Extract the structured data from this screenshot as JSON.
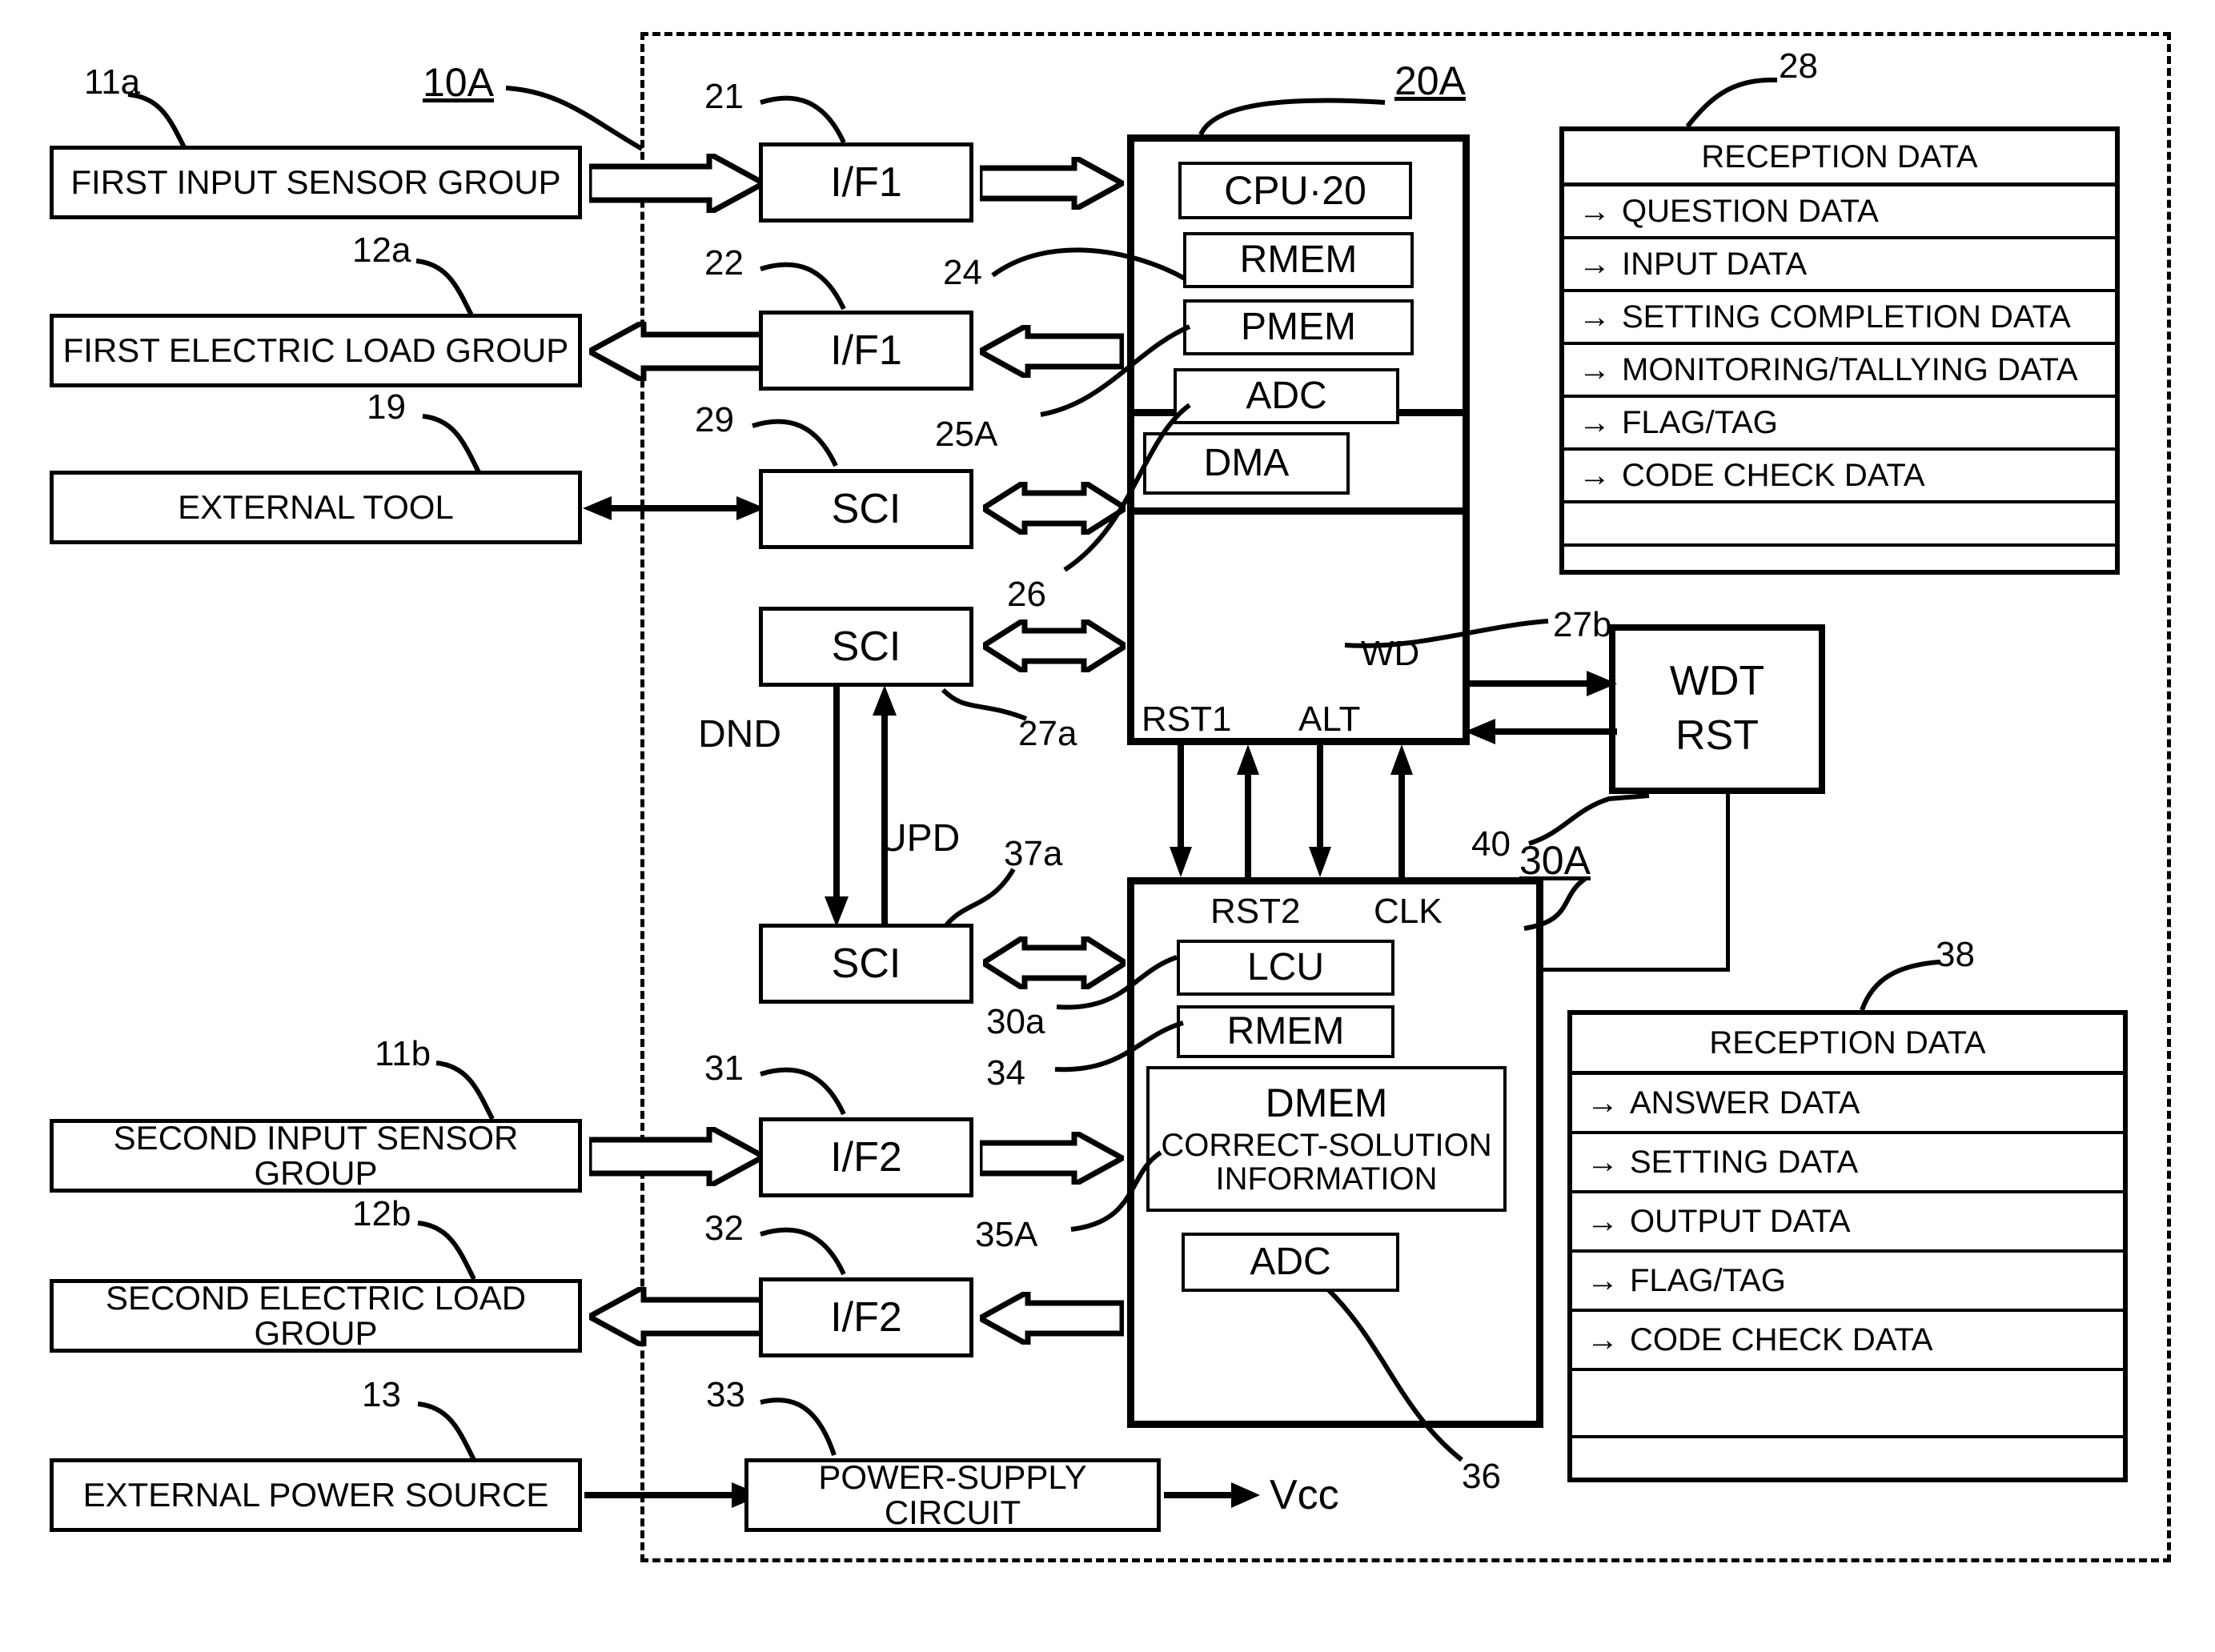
{
  "figure": {
    "outer_frame_label": "10A"
  },
  "external_blocks": [
    {
      "id": "first-input-sensor-group",
      "label": "FIRST INPUT SENSOR GROUP",
      "ref": "11a"
    },
    {
      "id": "first-electric-load-group",
      "label": "FIRST ELECTRIC LOAD GROUP",
      "ref": "12a"
    },
    {
      "id": "external-tool",
      "label": "EXTERNAL TOOL",
      "ref": "19"
    },
    {
      "id": "second-input-sensor-group",
      "label": "SECOND INPUT SENSOR GROUP",
      "ref": "11b"
    },
    {
      "id": "second-electric-load-group",
      "label": "SECOND ELECTRIC LOAD GROUP",
      "ref": "12b"
    },
    {
      "id": "external-power-source",
      "label": "EXTERNAL POWER SOURCE",
      "ref": "13"
    }
  ],
  "interfaces": [
    {
      "id": "if1-in",
      "label": "I/F1",
      "ref": "21"
    },
    {
      "id": "if1-out",
      "label": "I/F1",
      "ref": "22"
    },
    {
      "id": "sci-tool",
      "label": "SCI",
      "ref": "29"
    },
    {
      "id": "sci-comm",
      "label": "SCI",
      "ref": "27a"
    },
    {
      "id": "sci-sub",
      "label": "SCI",
      "ref": "37a"
    },
    {
      "id": "if2-in",
      "label": "I/F2",
      "ref": "31"
    },
    {
      "id": "if2-out",
      "label": "I/F2",
      "ref": "32"
    },
    {
      "id": "power-supply-circuit",
      "label": "POWER-SUPPLY CIRCUIT",
      "ref": "33"
    }
  ],
  "main_unit": {
    "ref": "20A",
    "modules": [
      {
        "id": "cpu",
        "label": "CPU·20"
      },
      {
        "id": "rmem",
        "label": "RMEM",
        "ref": "24"
      },
      {
        "id": "pmem",
        "label": "PMEM",
        "ref": "25A"
      },
      {
        "id": "adc",
        "label": "ADC",
        "ref": "26"
      },
      {
        "id": "dma",
        "label": "DMA",
        "ref": "27b"
      }
    ],
    "pins": {
      "rst1": "RST1",
      "alt": "ALT",
      "wd": "WD"
    }
  },
  "sub_unit": {
    "ref": "30A",
    "pins": {
      "rst2": "RST2",
      "clk": "CLK"
    },
    "modules": [
      {
        "id": "lcu",
        "label": "LCU",
        "ref": "30a"
      },
      {
        "id": "rmem2",
        "label": "RMEM",
        "ref": "34"
      },
      {
        "id": "dmem",
        "label": "DMEM",
        "sub1": "CORRECT-SOLUTION",
        "sub2": "INFORMATION",
        "ref": "35A"
      },
      {
        "id": "adc2",
        "label": "ADC",
        "ref": "36"
      }
    ]
  },
  "watchdog": {
    "line1": "WDT",
    "line2": "RST",
    "ref": "40"
  },
  "signals": {
    "dnd": "DND",
    "upd": "UPD",
    "vcc": "Vcc"
  },
  "tables": [
    {
      "id": "reception-data-main",
      "ref": "28",
      "header": "RECEPTION DATA",
      "arrow": "→",
      "rows": [
        "QUESTION DATA",
        "INPUT DATA",
        "SETTING COMPLETION DATA",
        "MONITORING/TALLYING DATA",
        "FLAG/TAG",
        "CODE CHECK DATA"
      ],
      "blank_rows": 2
    },
    {
      "id": "reception-data-sub",
      "ref": "38",
      "header": "RECEPTION DATA",
      "arrow": "→",
      "rows": [
        "ANSWER DATA",
        "SETTING DATA",
        "OUTPUT DATA",
        "FLAG/TAG",
        "CODE CHECK DATA"
      ],
      "blank_rows": 2
    }
  ],
  "colors": {
    "ink": "#000000",
    "paper": "#ffffff"
  }
}
